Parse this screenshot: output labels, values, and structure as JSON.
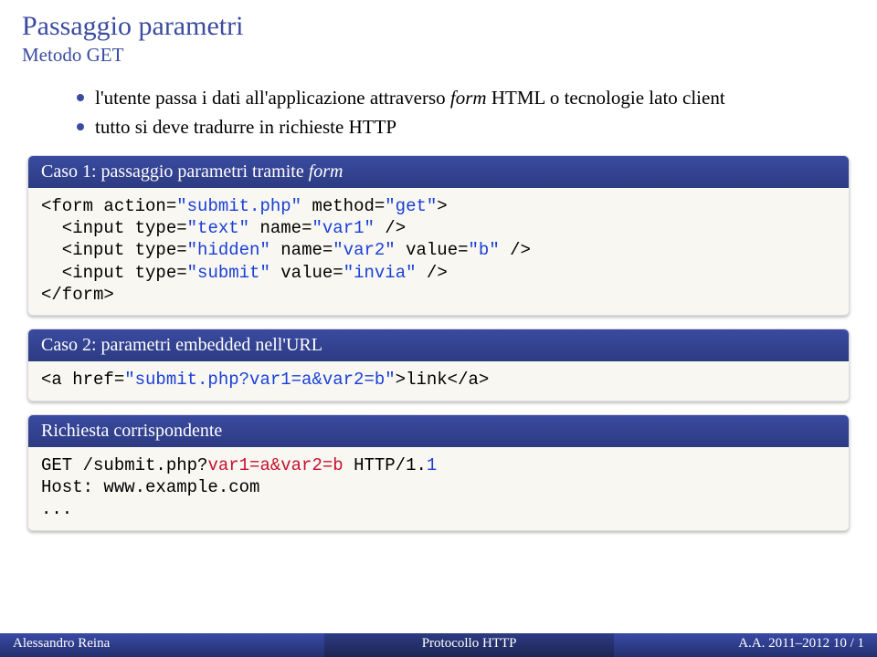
{
  "title": "Passaggio parametri",
  "subtitle": "Metodo GET",
  "bullets": [
    {
      "pre": "l'utente passa i dati all'applicazione attraverso ",
      "ital": "form",
      "post": " HTML o tecnologie lato client"
    },
    {
      "pre": "tutto si deve tradurre in richieste HTTP",
      "ital": "",
      "post": ""
    }
  ],
  "block1": {
    "header_pre": "Caso 1: passaggio parametri tramite ",
    "header_ital": "form",
    "code": {
      "l1a": "<form action=",
      "l1b": "\"submit.php\"",
      "l1c": " method=",
      "l1d": "\"get\"",
      "l1e": ">",
      "l2a": "  <input type=",
      "l2b": "\"text\"",
      "l2c": " name=",
      "l2d": "\"var1\"",
      "l2e": " />",
      "l3a": "  <input type=",
      "l3b": "\"hidden\"",
      "l3c": " name=",
      "l3d": "\"var2\"",
      "l3e": " value=",
      "l3f": "\"b\"",
      "l3g": " />",
      "l4a": "  <input type=",
      "l4b": "\"submit\"",
      "l4c": " value=",
      "l4d": "\"invia\"",
      "l4e": " />",
      "l5": "</form>"
    }
  },
  "block2": {
    "header": "Caso 2: parametri embedded nell'URL",
    "code": {
      "l1a": "<a href=",
      "l1b": "\"submit.php?var1=a&var2=b\"",
      "l1c": ">link</a>"
    }
  },
  "block3": {
    "header": "Richiesta corrispondente",
    "code": {
      "l1a": "GET /submit.php?",
      "l1b": "var1=a&var2=b",
      "l1c": " HTTP/1.",
      "l1d": "1",
      "l2": "Host: www.example.com",
      "l3": "..."
    }
  },
  "footer": {
    "left": "Alessandro Reina",
    "mid": "Protocollo HTTP",
    "right": "A.A. 2011–2012    10 / 1"
  }
}
